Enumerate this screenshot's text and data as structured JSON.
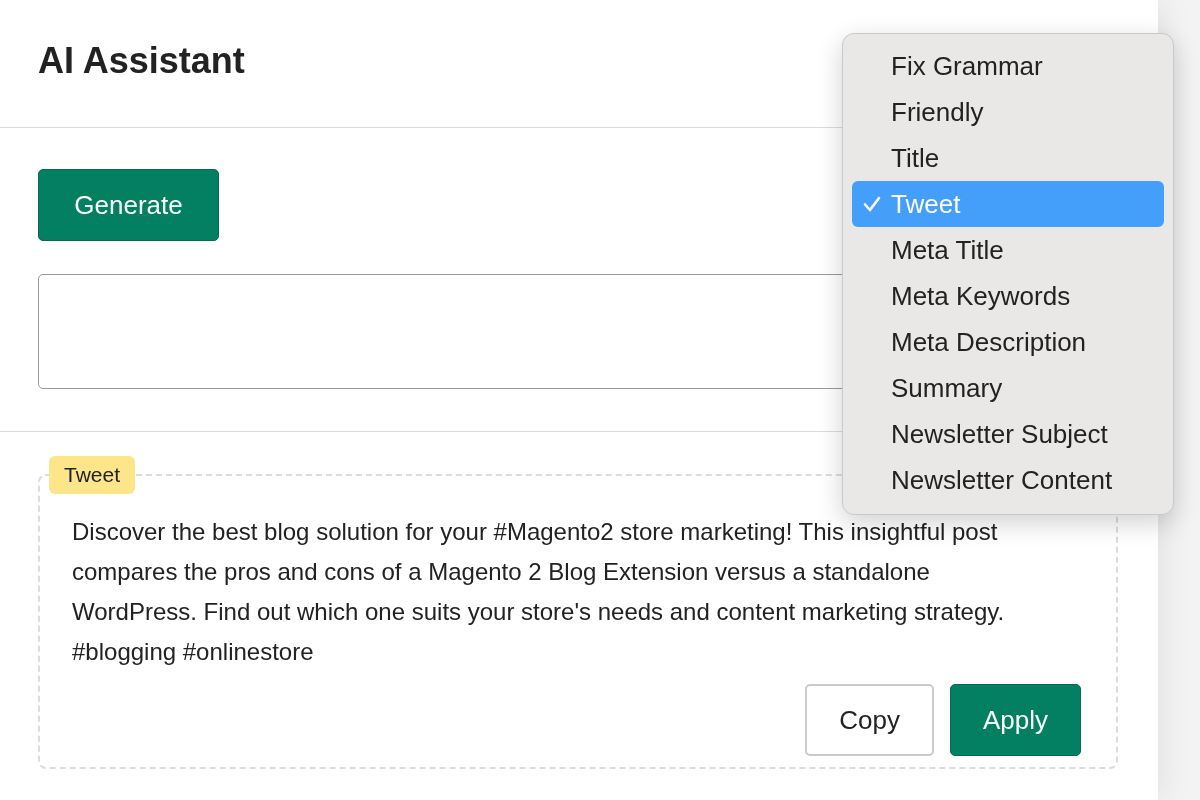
{
  "header": {
    "title": "AI Assistant"
  },
  "generate_button": {
    "label": "Generate"
  },
  "result": {
    "badge": "Tweet",
    "text": "Discover the best blog solution for your #Magento2 store marketing! This insightful post compares the pros and cons of a Magento 2 Blog Extension versus a standalone WordPress. Find out which one suits your store's needs and content marketing strategy. #blogging #onlinestore"
  },
  "actions": [
    {
      "label": "Copy",
      "kind": "secondary"
    },
    {
      "label": "Apply",
      "kind": "primary"
    }
  ],
  "menu": {
    "items": [
      {
        "label": "Fix Grammar",
        "selected": false
      },
      {
        "label": "Friendly",
        "selected": false
      },
      {
        "label": "Title",
        "selected": false
      },
      {
        "label": "Tweet",
        "selected": true
      },
      {
        "label": "Meta Title",
        "selected": false
      },
      {
        "label": "Meta Keywords",
        "selected": false
      },
      {
        "label": "Meta Description",
        "selected": false
      },
      {
        "label": "Summary",
        "selected": false
      },
      {
        "label": "Newsletter Subject",
        "selected": false
      },
      {
        "label": "Newsletter Content",
        "selected": false
      }
    ]
  }
}
